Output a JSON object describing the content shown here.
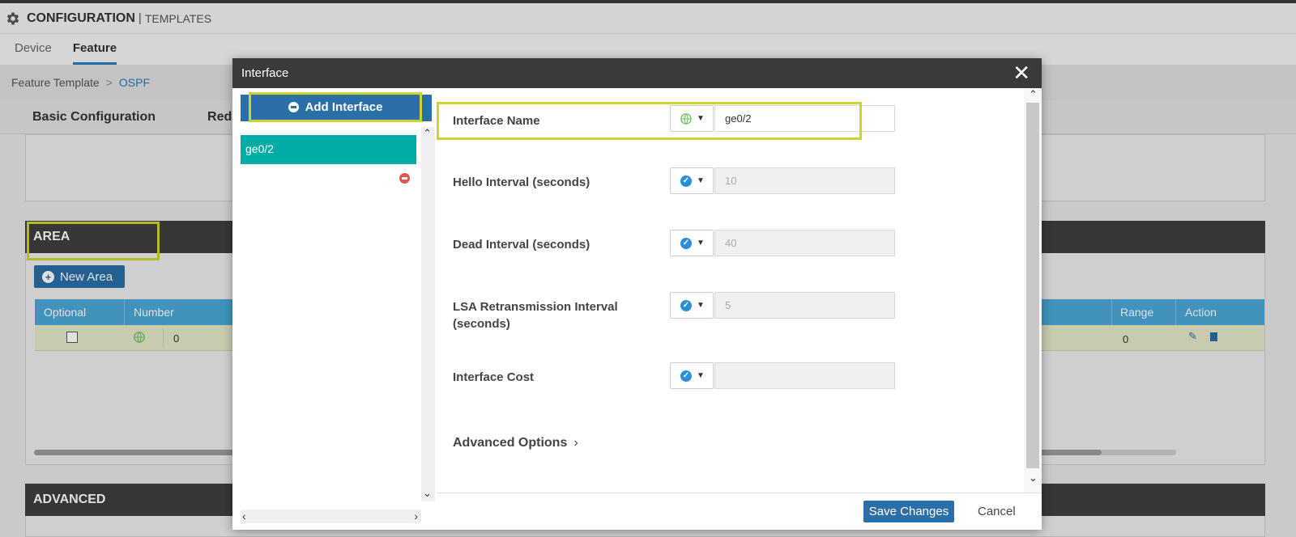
{
  "header": {
    "title": "CONFIGURATION",
    "separator": "|",
    "subtitle": "TEMPLATES"
  },
  "tabs": [
    {
      "label": "Device"
    },
    {
      "label": "Feature"
    }
  ],
  "breadcrumb": {
    "root": "Feature Template",
    "chevron": ">",
    "current": "OSPF"
  },
  "subtabs": [
    {
      "label": "Basic Configuration"
    },
    {
      "label": "Redis"
    }
  ],
  "area": {
    "title": "AREA",
    "new_button": "New Area",
    "columns": {
      "optional": "Optional",
      "number": "Number",
      "range": "Range",
      "action": "Action"
    },
    "row": {
      "number": "0",
      "range": "0"
    }
  },
  "advanced": {
    "title": "ADVANCED"
  },
  "modal": {
    "title": "Interface",
    "add_interface": "Add Interface",
    "interfaces": [
      "ge0/2"
    ],
    "fields": [
      {
        "label": "Interface Name",
        "value": "ge0/2",
        "scope_icon": "globe-icon"
      },
      {
        "label": "Hello Interval (seconds)",
        "value": "10",
        "scope_icon": "check-icon"
      },
      {
        "label": "Dead Interval (seconds)",
        "value": "40",
        "scope_icon": "check-icon"
      },
      {
        "label": "LSA Retransmission Interval (seconds)",
        "value": "5",
        "scope_icon": "check-icon"
      },
      {
        "label": "Interface Cost",
        "value": "",
        "scope_icon": "check-icon"
      }
    ],
    "advanced_options": "Advanced Options",
    "save": "Save Changes",
    "cancel": "Cancel"
  },
  "colors": {
    "primary": "#2a6fa8",
    "teal": "#00ada6",
    "highlight": "#cdd52a",
    "table_head": "#4aa8d8"
  }
}
